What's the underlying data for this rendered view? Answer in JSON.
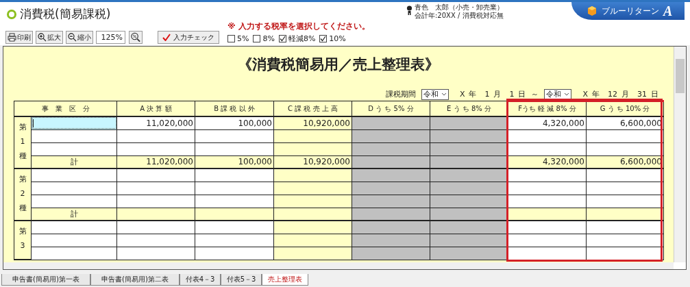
{
  "window": {
    "title": "消費税(簡易課税)"
  },
  "user": {
    "name": "青色　太郎（小売・卸売業）",
    "detail": "会計年:20XX / 消費税対応無"
  },
  "brand": {
    "name": "ブルーリターン",
    "mark": "A"
  },
  "toolbar": {
    "print": "印刷",
    "zoom_in": "拡大",
    "zoom_out": "縮小",
    "zoom": "125%",
    "check": "入力チェック"
  },
  "notice": "※ 入力する税率を選択してください。",
  "rates": [
    {
      "label": "5%",
      "checked": false
    },
    {
      "label": "8%",
      "checked": false
    },
    {
      "label": "軽減8%",
      "checked": true
    },
    {
      "label": "10%",
      "checked": true
    }
  ],
  "sheet": {
    "title": "《消費税簡易用／売上整理表》",
    "period": {
      "label": "課税期間",
      "separator": "～",
      "from": {
        "era": "令和",
        "parts": [
          {
            "value": "X",
            "unit": "年"
          },
          {
            "value": "1",
            "unit": "月"
          },
          {
            "value": "1",
            "unit": "日"
          }
        ]
      },
      "to": {
        "era": "令和",
        "parts": [
          {
            "value": "X",
            "unit": "年"
          },
          {
            "value": "12",
            "unit": "月"
          },
          {
            "value": "31",
            "unit": "日"
          }
        ]
      }
    },
    "category_heading": "事　業　区　分",
    "columns": [
      {
        "heading": "A 決 算 額",
        "kind": "input",
        "highlighted": false
      },
      {
        "heading": "B 課 税 以 外",
        "kind": "input",
        "highlighted": false
      },
      {
        "heading": "C 課 税 売 上 高",
        "kind": "computed",
        "highlighted": false
      },
      {
        "heading": "D う ち  5% 分",
        "kind": "disabled",
        "highlighted": false
      },
      {
        "heading": "E う ち  8% 分",
        "kind": "disabled",
        "highlighted": false
      },
      {
        "heading": "Fうち 軽 減 8% 分",
        "kind": "input",
        "highlighted": true
      },
      {
        "heading": "G う ち  10% 分",
        "kind": "input",
        "highlighted": true
      }
    ],
    "groups": [
      {
        "label": "第1種",
        "rows": [
          {
            "kind": "entry",
            "focused": true,
            "cells": [
              "11,020,000",
              "100,000",
              "10,920,000",
              null,
              null,
              "4,320,000",
              "6,600,000"
            ]
          },
          {
            "kind": "entry",
            "focused": false,
            "cells": [
              null,
              null,
              null,
              null,
              null,
              null,
              null
            ]
          },
          {
            "kind": "entry",
            "focused": false,
            "cells": [
              null,
              null,
              null,
              null,
              null,
              null,
              null
            ]
          },
          {
            "kind": "total",
            "label": "計",
            "focused": false,
            "cells": [
              "11,020,000",
              "100,000",
              "10,920,000",
              null,
              null,
              "4,320,000",
              "6,600,000"
            ]
          }
        ]
      },
      {
        "label": "第2種",
        "rows": [
          {
            "kind": "entry",
            "focused": false,
            "cells": [
              null,
              null,
              null,
              null,
              null,
              null,
              null
            ]
          },
          {
            "kind": "entry",
            "focused": false,
            "cells": [
              null,
              null,
              null,
              null,
              null,
              null,
              null
            ]
          },
          {
            "kind": "entry",
            "focused": false,
            "cells": [
              null,
              null,
              null,
              null,
              null,
              null,
              null
            ]
          },
          {
            "kind": "total",
            "label": "計",
            "focused": false,
            "cells": [
              null,
              null,
              null,
              null,
              null,
              null,
              null
            ]
          }
        ]
      },
      {
        "label": "第3",
        "rows": [
          {
            "kind": "entry",
            "focused": false,
            "cells": [
              null,
              null,
              null,
              null,
              null,
              null,
              null
            ]
          },
          {
            "kind": "entry",
            "focused": false,
            "cells": [
              null,
              null,
              null,
              null,
              null,
              null,
              null
            ]
          },
          {
            "kind": "entry",
            "focused": false,
            "cells": [
              null,
              null,
              null,
              null,
              null,
              null,
              null
            ]
          }
        ]
      }
    ]
  },
  "tabs": [
    {
      "label": "申告書(簡易用)第一表",
      "selected": false
    },
    {
      "label": "申告書(簡易用)第二表",
      "selected": false
    },
    {
      "label": "付表4－3",
      "selected": false
    },
    {
      "label": "付表5－3",
      "selected": false
    },
    {
      "label": "売上整理表",
      "selected": true
    }
  ]
}
